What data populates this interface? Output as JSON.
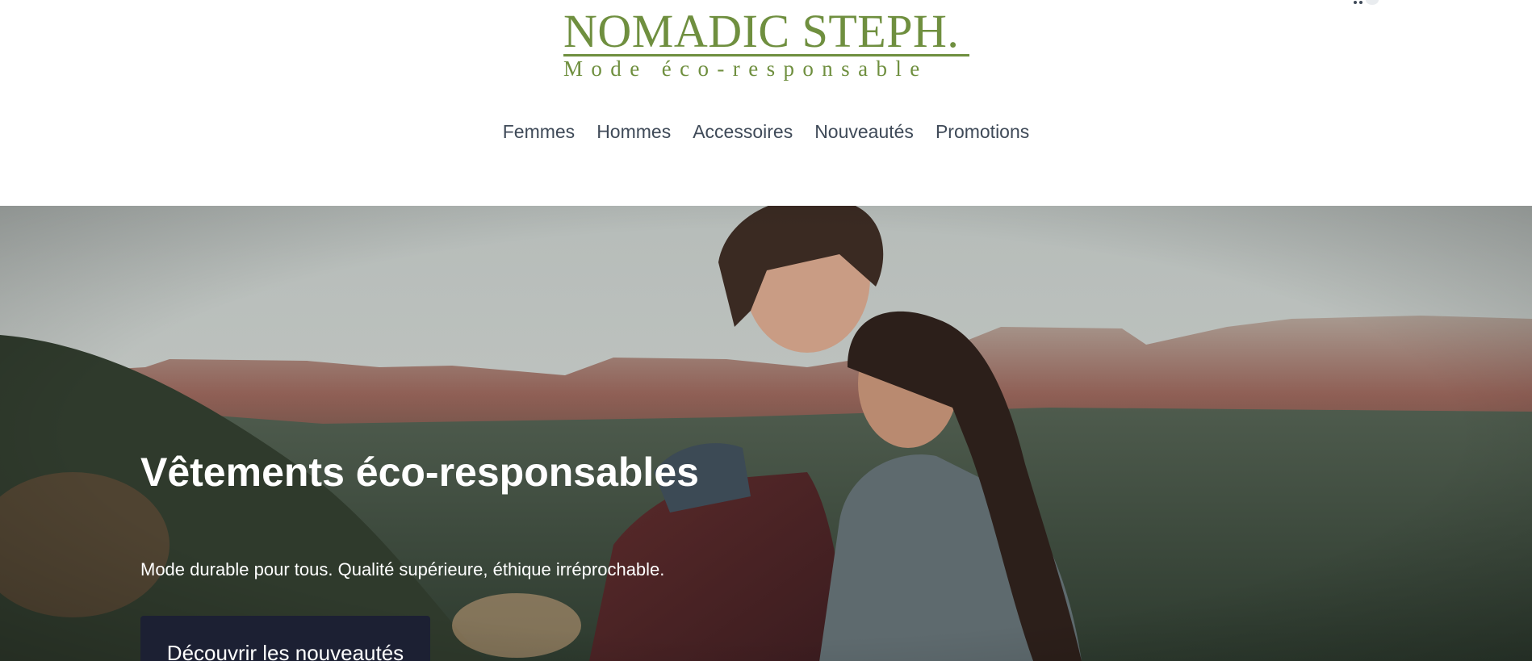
{
  "brand": {
    "name": "NOMADIC STEPH.",
    "tagline": "Mode éco-responsable",
    "color": "#6f8f3f"
  },
  "header": {
    "cart_icon": "shopping-cart-icon"
  },
  "nav": {
    "items": [
      {
        "label": "Femmes"
      },
      {
        "label": "Hommes"
      },
      {
        "label": "Accessoires"
      },
      {
        "label": "Nouveautés"
      },
      {
        "label": "Promotions"
      }
    ]
  },
  "hero": {
    "title": "Vêtements éco-responsables",
    "subtitle": "Mode durable pour tous. Qualité supérieure, éthique irréprochable.",
    "cta_label": "Découvrir les nouveautés",
    "cta_color": "#1c2033",
    "image": "couple-mountain-landscape-photo"
  }
}
